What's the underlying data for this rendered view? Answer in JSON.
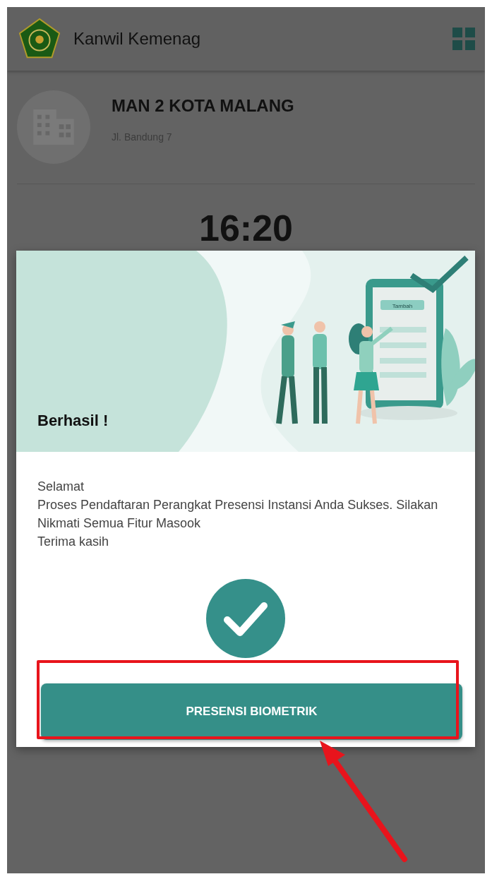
{
  "app_bar": {
    "title": "Kanwil Kemenag"
  },
  "institution": {
    "name": "MAN 2 KOTA MALANG",
    "address": "Jl. Bandung 7"
  },
  "clock": {
    "time": "16:20"
  },
  "dialog": {
    "illustration_label": "Tambah",
    "title": "Berhasil !",
    "message_lines": [
      "Selamat",
      "Proses Pendaftaran Perangkat Presensi Instansi Anda Sukses. Silakan Nikmati Semua Fitur Masook",
      "Terima kasih"
    ],
    "button": {
      "label": "PRESENSI BIOMETRIK",
      "highlighted": true
    }
  }
}
